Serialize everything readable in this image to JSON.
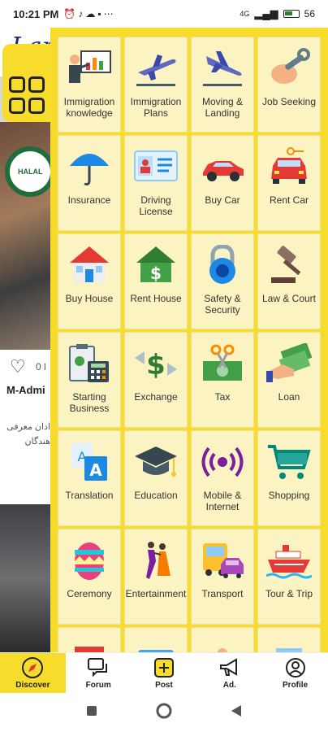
{
  "status_bar": {
    "time": "10:21 PM",
    "status_icons": [
      "alarm-icon",
      "tiktok-icon",
      "cloud-icon",
      "storage-icon",
      "more-icon"
    ],
    "network": "4G",
    "battery": "56"
  },
  "background": {
    "logo_text": "Lan",
    "likes": "0 l",
    "author": "M-Admi",
    "description": [
      "ادان معرفی",
      "هندگان"
    ],
    "halal_text": "HALAL"
  },
  "categories": [
    {
      "label": "Immigration knowledge",
      "icon": "presentation-icon"
    },
    {
      "label": "Immigration Plans",
      "icon": "airplane-takeoff-icon"
    },
    {
      "label": "Moving & Landing",
      "icon": "airplane-landing-icon"
    },
    {
      "label": "Job Seeking",
      "icon": "wrench-hand-icon"
    },
    {
      "label": "Insurance",
      "icon": "umbrella-icon"
    },
    {
      "label": "Driving License",
      "icon": "id-card-icon"
    },
    {
      "label": "Buy Car",
      "icon": "car-icon"
    },
    {
      "label": "Rent Car",
      "icon": "car-key-icon"
    },
    {
      "label": "Buy House",
      "icon": "house-icon"
    },
    {
      "label": "Rent House",
      "icon": "house-dollar-icon"
    },
    {
      "label": "Safety & Security",
      "icon": "padlock-icon"
    },
    {
      "label": "Law & Court",
      "icon": "gavel-icon"
    },
    {
      "label": "Starting Business",
      "icon": "clipboard-calculator-icon"
    },
    {
      "label": "Exchange",
      "icon": "dollar-exchange-icon"
    },
    {
      "label": "Tax",
      "icon": "scissors-money-icon"
    },
    {
      "label": "Loan",
      "icon": "hand-money-icon"
    },
    {
      "label": "Translation",
      "icon": "translation-icon"
    },
    {
      "label": "Education",
      "icon": "graduation-cap-icon"
    },
    {
      "label": "Mobile & Internet",
      "icon": "broadcast-icon"
    },
    {
      "label": "Shopping",
      "icon": "shopping-cart-icon"
    },
    {
      "label": "Ceremony",
      "icon": "easter-egg-icon"
    },
    {
      "label": "Entertainment",
      "icon": "dancers-icon"
    },
    {
      "label": "Transport",
      "icon": "bus-icon"
    },
    {
      "label": "Tour & Trip",
      "icon": "cruise-ship-icon"
    }
  ],
  "bottom_nav": [
    {
      "label": "Discover",
      "icon": "compass-icon",
      "active": true
    },
    {
      "label": "Forum",
      "icon": "chat-icon",
      "active": false
    },
    {
      "label": "Post",
      "icon": "plus-square-icon",
      "active": false
    },
    {
      "label": "Ad.",
      "icon": "megaphone-icon",
      "active": false
    },
    {
      "label": "Profile",
      "icon": "person-icon",
      "active": false
    }
  ],
  "system_nav": [
    "recents-icon",
    "home-icon",
    "back-icon"
  ],
  "colors": {
    "accent": "#F7DC2B",
    "tile": "#FBF3C2"
  }
}
